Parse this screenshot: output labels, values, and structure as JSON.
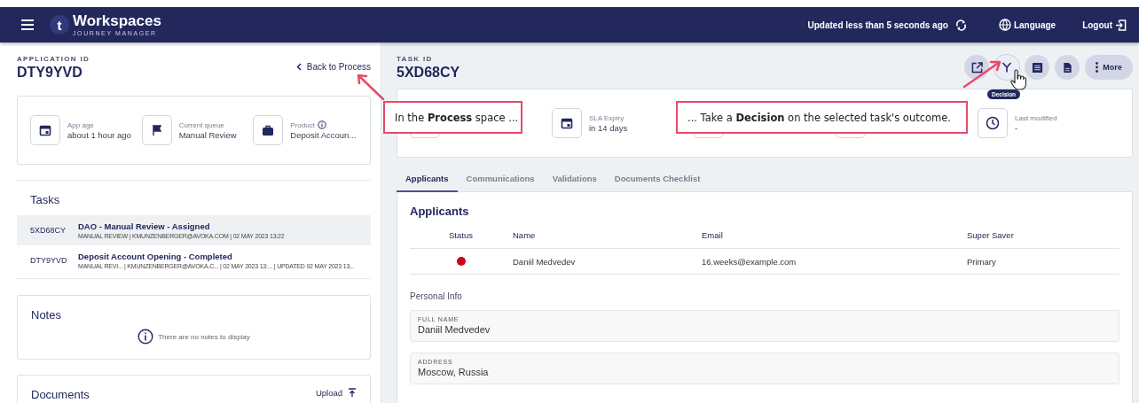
{
  "topbar": {
    "logo_letter": "t",
    "brand": "Workspaces",
    "subtitle": "JOURNEY MANAGER",
    "status": "Updated less than 5 seconds ago",
    "language": "Language",
    "logout": "Logout"
  },
  "application": {
    "label": "APPLICATION ID",
    "id": "DTY9YVD",
    "back_link": "Back to Process"
  },
  "app_stats": [
    {
      "kind": "calendar",
      "label": "App age",
      "value": "about 1 hour ago",
      "info": false
    },
    {
      "kind": "flag",
      "label": "Current queue",
      "value": "Manual Review",
      "info": false
    },
    {
      "kind": "briefcase",
      "label": "Product",
      "value": "Deposit Accoun...",
      "info": true
    }
  ],
  "tasks": {
    "title": "Tasks",
    "items": [
      {
        "id": "5XD68CY",
        "title": "DAO - Manual Review - Assigned",
        "meta": "MANUAL REVIEW | KMUNZENBERGER@AVOKA.COM | 02 MAY 2023 13:22",
        "selected": true
      },
      {
        "id": "DTY9YVD",
        "title": "Deposit Account Opening - Completed",
        "meta": "MANUAL REVI...  | KMUNZENBERGER@AVOKA.C... | 02 MAY 2023 13:... | UPDATED 02 MAY 2023 13...",
        "selected": false
      }
    ]
  },
  "notes": {
    "title": "Notes",
    "empty_message": "There are no notes to display"
  },
  "documents": {
    "title": "Documents",
    "upload": "Upload"
  },
  "task": {
    "label": "TASK ID",
    "id": "5XD68CY",
    "tooltip": "Decision",
    "actions": [
      {
        "kind": "open-external",
        "hovered": false
      },
      {
        "kind": "decision",
        "hovered": true
      },
      {
        "kind": "list",
        "hovered": false
      },
      {
        "kind": "document",
        "hovered": false
      },
      {
        "kind": "more",
        "label": "More",
        "hovered": false
      }
    ]
  },
  "task_stats": [
    {
      "kind": "blank"
    },
    {
      "kind": "calendar",
      "label": "SLA Expiry",
      "value": "in 14 days"
    },
    {
      "kind": "blank"
    },
    {
      "kind": "blank"
    },
    {
      "kind": "clock",
      "label": "Last modified",
      "value": "-"
    }
  ],
  "tabs": [
    {
      "label": "Applicants",
      "selected": true
    },
    {
      "label": "Communications",
      "selected": false
    },
    {
      "label": "Validations",
      "selected": false
    },
    {
      "label": "Documents Checklist",
      "selected": false
    }
  ],
  "applicants": {
    "title": "Applicants",
    "columns": [
      "Status",
      "Name",
      "Email",
      "Super Saver"
    ],
    "rows": [
      {
        "color": "#d0021b",
        "name": "Daniil Medvedev",
        "email": "16.weeks@example.com",
        "super_saver": "Primary"
      }
    ]
  },
  "personal_info": {
    "title": "Personal Info",
    "fields": [
      {
        "label": "FULL NAME",
        "value": "Daniil Medvedev"
      },
      {
        "label": "ADDRESS",
        "value": "Moscow, Russia"
      }
    ]
  },
  "callouts": [
    {
      "text": "In the **Process** space ..."
    },
    {
      "text": "... Take a **Decision** on the selected task's outcome."
    }
  ]
}
